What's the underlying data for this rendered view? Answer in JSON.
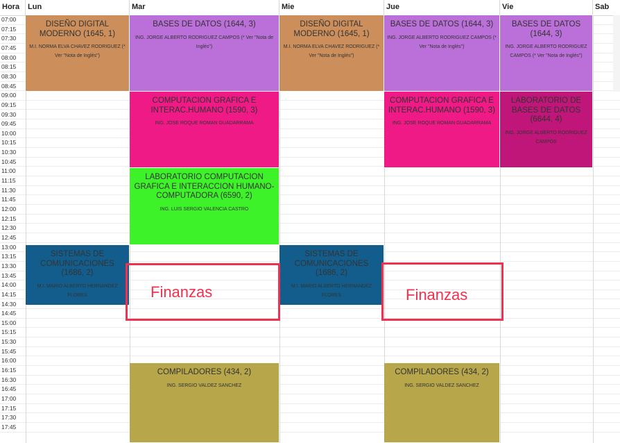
{
  "days": [
    "Hora",
    "Lun",
    "Mar",
    "Mie",
    "Jue",
    "Vie",
    "Sab"
  ],
  "times": [
    "07:00",
    "07:15",
    "07:30",
    "07:45",
    "08:00",
    "08:15",
    "08:30",
    "08:45",
    "09:00",
    "09:15",
    "09:30",
    "09:45",
    "10:00",
    "10:15",
    "10:30",
    "10:45",
    "11:00",
    "11:15",
    "11:30",
    "11:45",
    "12:00",
    "12:15",
    "12:30",
    "12:45",
    "13:00",
    "13:15",
    "13:30",
    "13:45",
    "14:00",
    "14:15",
    "14:30",
    "14:45",
    "15:00",
    "15:15",
    "15:30",
    "15:45",
    "16:00",
    "16:15",
    "16:30",
    "16:45",
    "17:00",
    "17:15",
    "17:30",
    "17:45"
  ],
  "events": [
    {
      "id": "diseno-lun",
      "day": "Lun",
      "title": "DISEÑO DIGITAL MODERNO (1645, 1)",
      "teacher": "M.I. NORMA ELVA CHAVEZ RODRIGUEZ (* Ver \"Nota de Inglés\")",
      "color": "#cc8f5c"
    },
    {
      "id": "bases-mar",
      "day": "Mar",
      "title": "BASES DE DATOS (1644, 3)",
      "teacher": "ING. JORGE ALBERTO RODRIGUEZ CAMPOS (* Ver \"Nota de Inglés\")",
      "color": "#bb6fd8"
    },
    {
      "id": "diseno-mie",
      "day": "Mie",
      "title": "DISEÑO DIGITAL MODERNO (1645, 1)",
      "teacher": "M.I. NORMA ELVA CHAVEZ RODRIGUEZ (* Ver \"Nota de Inglés\")",
      "color": "#cc8f5c"
    },
    {
      "id": "bases-jue",
      "day": "Jue",
      "title": "BASES DE DATOS (1644, 3)",
      "teacher": "ING. JORGE ALBERTO RODRIGUEZ CAMPOS (* Ver \"Nota de Inglés\")",
      "color": "#bb6fd8"
    },
    {
      "id": "bases-vie",
      "day": "Vie",
      "title": "BASES DE DATOS (1644, 3)",
      "teacher": "ING. JORGE ALBERTO RODRIGUEZ CAMPOS (* Ver \"Nota de Inglés\")",
      "color": "#bb6fd8"
    },
    {
      "id": "compgraf-mar",
      "day": "Mar",
      "title": "COMPUTACION GRAFICA E INTERAC.HUMANO (1590, 3)",
      "teacher": "ING. JOSE ROQUE ROMAN GUADARRAMA",
      "color": "#f01a86"
    },
    {
      "id": "compgraf-jue",
      "day": "Jue",
      "title": "COMPUTACION GRAFICA E INTERAC.HUMANO (1590, 3)",
      "teacher": "ING. JOSE ROQUE ROMAN GUADARRAMA",
      "color": "#f01a86"
    },
    {
      "id": "labbd-vie",
      "day": "Vie",
      "title": "LABORATORIO DE BASES DE DATOS (6644, 4)",
      "teacher": "ING. JORGE ALBERTO RODRIGUEZ CAMPOS",
      "color": "#c0167a"
    },
    {
      "id": "labcg-mar",
      "day": "Mar",
      "title": "LABORATORIO COMPUTACION GRAFICA E INTERACCION HUMANO-COMPUTADORA (6590, 2)",
      "teacher": "ING. LUIS SERGIO VALENCIA CASTRO",
      "color": "#3ef22a"
    },
    {
      "id": "sist-lun",
      "day": "Lun",
      "title": "SISTEMAS DE COMUNICACIONES (1686, 2)",
      "teacher": "M.I. MARIO ALBERTO HERNANDEZ FLORES",
      "color": "#135d8c"
    },
    {
      "id": "sist-mie",
      "day": "Mie",
      "title": "SISTEMAS DE COMUNICACIONES (1686, 2)",
      "teacher": "M.I. MARIO ALBERTO HERNANDEZ FLORES",
      "color": "#135d8c"
    },
    {
      "id": "comp-mar",
      "day": "Mar",
      "title": "COMPILADORES (434, 2)",
      "teacher": "ING. SERGIO VALDEZ SANCHEZ",
      "color": "#b7a64a"
    },
    {
      "id": "comp-jue",
      "day": "Jue",
      "title": "COMPILADORES (434, 2)",
      "teacher": "ING. SERGIO VALDEZ SANCHEZ",
      "color": "#b7a64a"
    }
  ],
  "annotations": [
    {
      "id": "finanzas-1",
      "text": "Finanzas",
      "color": "#f2304f"
    },
    {
      "id": "finanzas-2",
      "text": "Finanzas",
      "color": "#f2304f"
    }
  ]
}
